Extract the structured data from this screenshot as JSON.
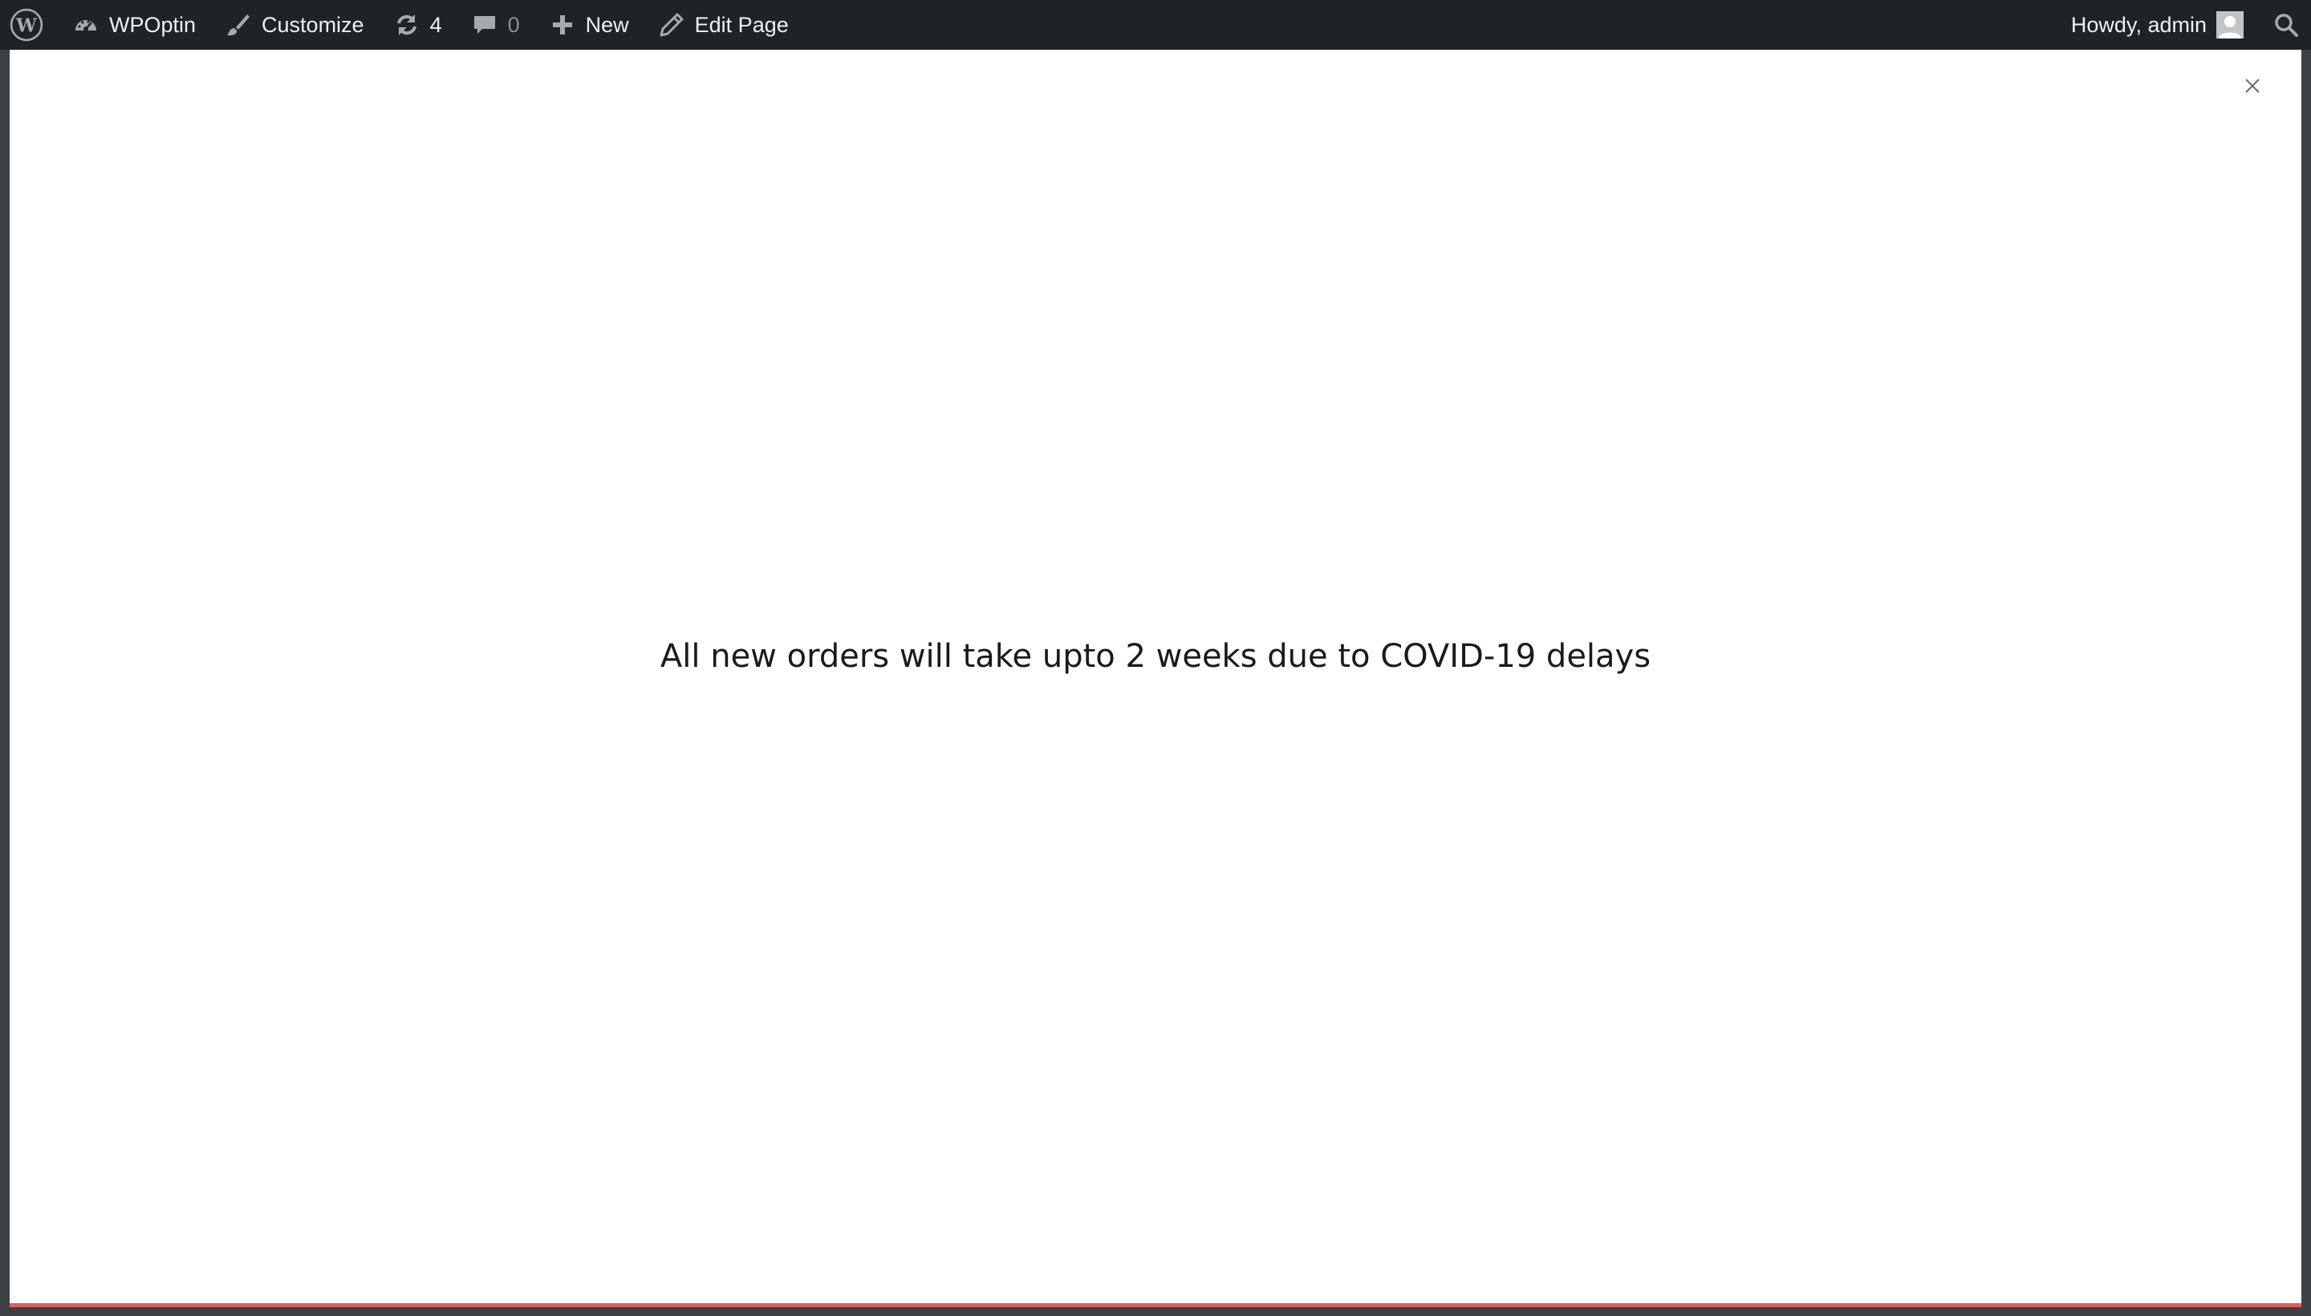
{
  "adminbar": {
    "site_name": "WPOptin",
    "customize_label": "Customize",
    "updates_count": "4",
    "comments_count": "0",
    "new_label": "New",
    "edit_page_label": "Edit Page",
    "greeting": "Howdy, admin"
  },
  "icons": {
    "wp_logo": "wordpress-logo-icon",
    "site": "dashboard-gauge-icon",
    "customize": "paintbrush-icon",
    "updates": "refresh-icon",
    "comments": "comment-bubble-icon",
    "new": "plus-icon",
    "edit": "pencil-icon",
    "avatar": "user-avatar-icon",
    "search": "search-icon",
    "close": "close-icon"
  },
  "popup": {
    "message": "All new orders will take upto 2 weeks due to COVID-19 delays"
  },
  "colors": {
    "adminbar_bg": "#1d2327",
    "adminbar_text": "#f0f0f1",
    "muted_text": "#8c8f94",
    "page_bg": "#ffffff",
    "bottom_accent": "#e65c5c"
  }
}
